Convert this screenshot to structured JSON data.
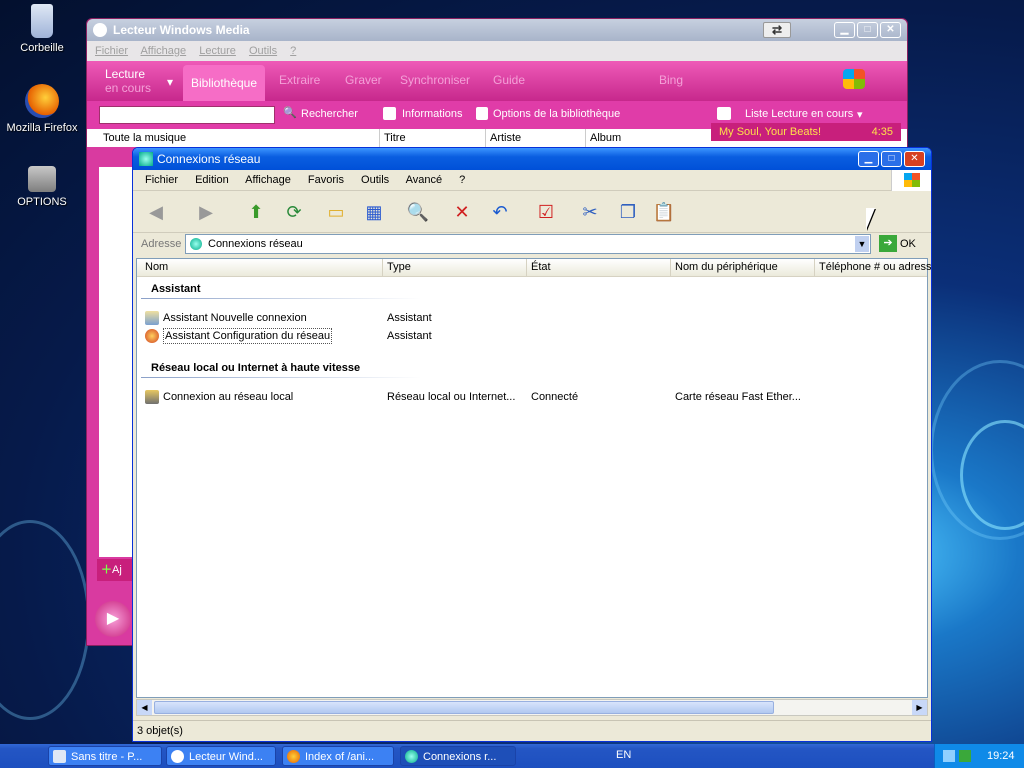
{
  "desktop": {
    "icons": [
      {
        "label": "Corbeille"
      },
      {
        "label": "Mozilla Firefox"
      },
      {
        "label": "OPTIONS"
      }
    ]
  },
  "wmp": {
    "title": "Lecteur Windows Media",
    "menu": [
      "Fichier",
      "Affichage",
      "Lecture",
      "Outils",
      "?"
    ],
    "tabs": {
      "lecture": "Lecture",
      "encours": "en cours",
      "biblio": "Bibliothèque",
      "extraire": "Extraire",
      "graver": "Graver",
      "sync": "Synchroniser",
      "guide": "Guide",
      "bing": "Bing"
    },
    "toolbar": {
      "search": "Rechercher",
      "info": "Informations",
      "options": "Options de la bibliothèque",
      "playlist": "Liste Lecture en cours"
    },
    "cols": {
      "all": "Toute la musique",
      "titre": "Titre",
      "artiste": "Artiste",
      "album": "Album"
    },
    "nowplaying": {
      "track": "My Soul, Your Beats!",
      "time": "4:35"
    },
    "add": "Aj"
  },
  "explorer": {
    "title": "Connexions réseau",
    "menu": [
      "Fichier",
      "Edition",
      "Affichage",
      "Favoris",
      "Outils",
      "Avancé",
      "?"
    ],
    "address": {
      "label": "Adresse",
      "value": "Connexions réseau",
      "go": "OK"
    },
    "columns": [
      "Nom",
      "Type",
      "État",
      "Nom du périphérique",
      "Téléphone # ou adress"
    ],
    "groups": [
      {
        "name": "Assistant",
        "items": [
          {
            "name": "Assistant Nouvelle connexion",
            "type": "Assistant",
            "state": "",
            "device": ""
          },
          {
            "name": "Assistant Configuration du réseau",
            "type": "Assistant",
            "state": "",
            "device": ""
          }
        ]
      },
      {
        "name": "Réseau local ou Internet à haute vitesse",
        "items": [
          {
            "name": "Connexion au réseau local",
            "type": "Réseau local ou Internet...",
            "state": "Connecté",
            "device": "Carte réseau Fast Ether..."
          }
        ]
      }
    ],
    "status": "3 objet(s)"
  },
  "taskbar": {
    "tasks": [
      {
        "label": "Sans titre - P..."
      },
      {
        "label": "Lecteur Wind..."
      },
      {
        "label": "Index of /ani..."
      },
      {
        "label": "Connexions r..."
      }
    ],
    "lang": "EN",
    "clock": "19:24"
  },
  "colors": {
    "wmp_accent": "#d93aa0",
    "xp_title": "#0a5ee0",
    "taskbar": "#2456c4"
  }
}
